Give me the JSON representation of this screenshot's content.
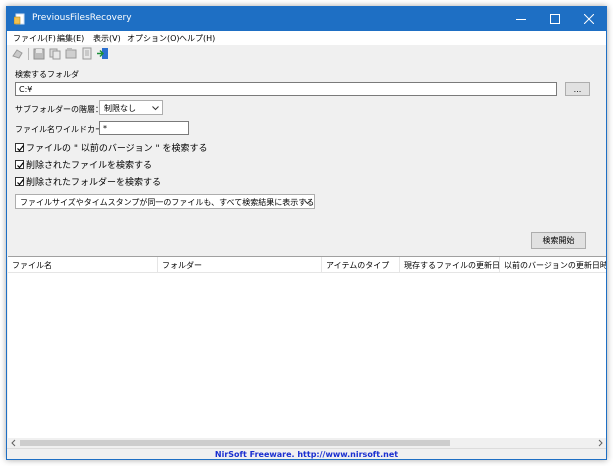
{
  "window": {
    "title": "PreviousFilesRecovery",
    "accent": "#1e6fc4"
  },
  "menu": [
    "ファイル(F)",
    "編集(E)",
    "表示(V)",
    "オプション(O)",
    "ヘルプ(H)"
  ],
  "form": {
    "folder_label": "検索するフォルダ",
    "folder_value": "C:¥",
    "browse_label": "...",
    "subfolder_label": "サブフォルダーの階層：",
    "subfolder_value": "制限なし",
    "wildcard_label": "ファイル名ワイルドカー",
    "wildcard_value": "*",
    "checkboxes": [
      {
        "label": "ファイルの \" 以前のバージョン \" を検索する",
        "checked": true
      },
      {
        "label": "削除されたファイルを検索する",
        "checked": true
      },
      {
        "label": "削除されたフォルダーを検索する",
        "checked": true
      }
    ],
    "filter_value": "ファイルサイズやタイムスタンプが同一のファイルも、すべて検索結果に表示する",
    "search_button": "検索開始"
  },
  "list": {
    "columns": [
      "ファイル名",
      "フォルダー",
      "アイテムのタイプ",
      "現存するファイルの更新日時",
      "以前のバージョンの更新日時"
    ]
  },
  "status": {
    "text": "NirSoft Freeware.  http://www.nirsoft.net",
    "color": "#1a2fd0"
  }
}
